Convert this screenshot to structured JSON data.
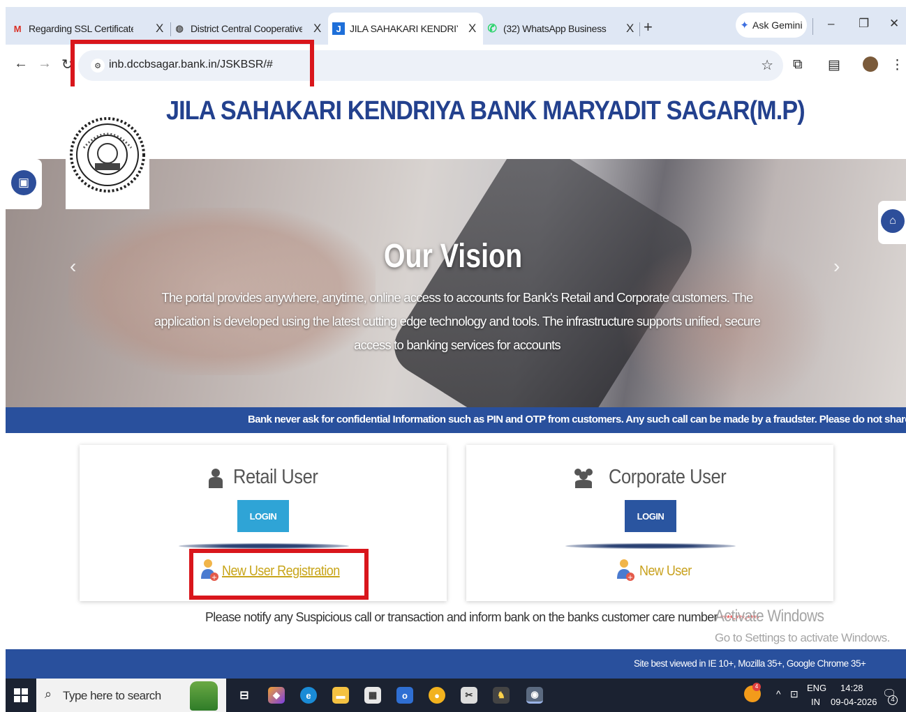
{
  "browser": {
    "tabs": [
      {
        "label": "Regarding SSL Certificate - cbs",
        "icon": "gmail-icon",
        "icon_glyph": "M",
        "icon_color": "#d93025"
      },
      {
        "label": "District Central Cooperative Ba",
        "icon": "globe-icon",
        "icon_glyph": "◍",
        "icon_color": "#555555"
      },
      {
        "label": "JILA SAHAKARI KENDRIYA BAN",
        "icon": "site-favicon-icon",
        "icon_glyph": "J",
        "icon_color": "#1e6fd9"
      },
      {
        "label": "(32) WhatsApp Business",
        "icon": "whatsapp-icon",
        "icon_glyph": "✆",
        "icon_color": "#25d366"
      }
    ],
    "close_glyph": "X",
    "new_tab_glyph": "+",
    "gemini_label": "Ask Gemini",
    "url": "inb.dccbsagar.bank.in/JSKBSR/#"
  },
  "page": {
    "bank_title": "JILA SAHAKARI KENDRIYA BANK MARYADIT SAGAR(M.P)",
    "vision_title": "Our Vision",
    "vision_text": "The portal provides anywhere, anytime, online access to accounts for Bank's Retail and Corporate customers. The application is developed using the latest cutting edge technology and tools. The infrastructure supports unified, secure access to banking services for accounts",
    "ticker": "Bank never ask for confidential Information such as PIN and OTP from customers. Any such call can be made by a fraudster. Please do not share personal",
    "retail": {
      "title": "Retail User",
      "login": "LOGIN",
      "registration": "New User Registration"
    },
    "corporate": {
      "title": "Corporate User",
      "login": "LOGIN",
      "registration": "New User"
    },
    "notify_text": "Please notify any Suspicious call or transaction and inform bank on the banks customer care number",
    "notify_number": "****-***-****",
    "footer": "Site best viewed in IE 10+, Mozilla 35+, Google Chrome 35+",
    "colors": {
      "title_blue": "#23418e",
      "bar_blue": "#29509d",
      "login_retail": "#2fa4d6",
      "login_corporate": "#2a55a0",
      "link_retail": "#c8a51a",
      "link_corporate": "#c9a21f",
      "highlight_red": "#d9161c"
    }
  },
  "windows": {
    "activate_title": "Activate Windows",
    "activate_sub": "Go to Settings to activate Windows."
  },
  "taskbar": {
    "search_placeholder": "Type here to search",
    "lang_top": "ENG",
    "lang_bottom": "IN",
    "time": "14:28",
    "date": "09-04-2026",
    "notification_count": "4",
    "tray_badge": "4"
  }
}
